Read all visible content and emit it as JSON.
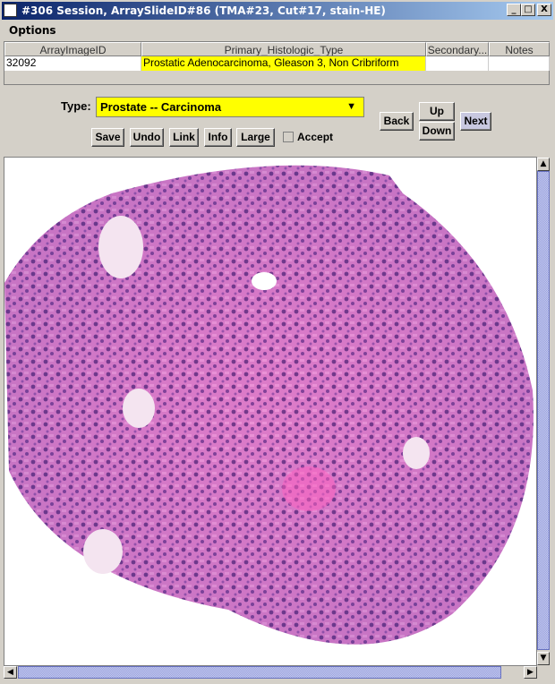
{
  "window": {
    "title": "#306 Session, ArraySlideID#86 (TMA#23, Cut#17, stain-HE)",
    "minimize": "_",
    "maximize": "□",
    "close": "X"
  },
  "menu": {
    "options": "Options"
  },
  "table": {
    "headers": [
      "ArrayImageID",
      "Primary_Histologic_Type",
      "Secondary...",
      "Notes"
    ],
    "rows": [
      [
        "32092",
        "Prostatic Adenocarcinoma, Gleason 3, Non Cribriform",
        "",
        ""
      ]
    ],
    "highlight_color": "#ffff00"
  },
  "controls": {
    "type_label": "Type:",
    "type_value": "Prostate -- Carcinoma",
    "save": "Save",
    "undo": "Undo",
    "link": "Link",
    "info": "Info",
    "large": "Large",
    "accept": "Accept",
    "accept_checked": false,
    "back": "Back",
    "up": "Up",
    "down": "Down",
    "next": "Next"
  },
  "image": {
    "content": "H&E stained prostate tissue core"
  }
}
